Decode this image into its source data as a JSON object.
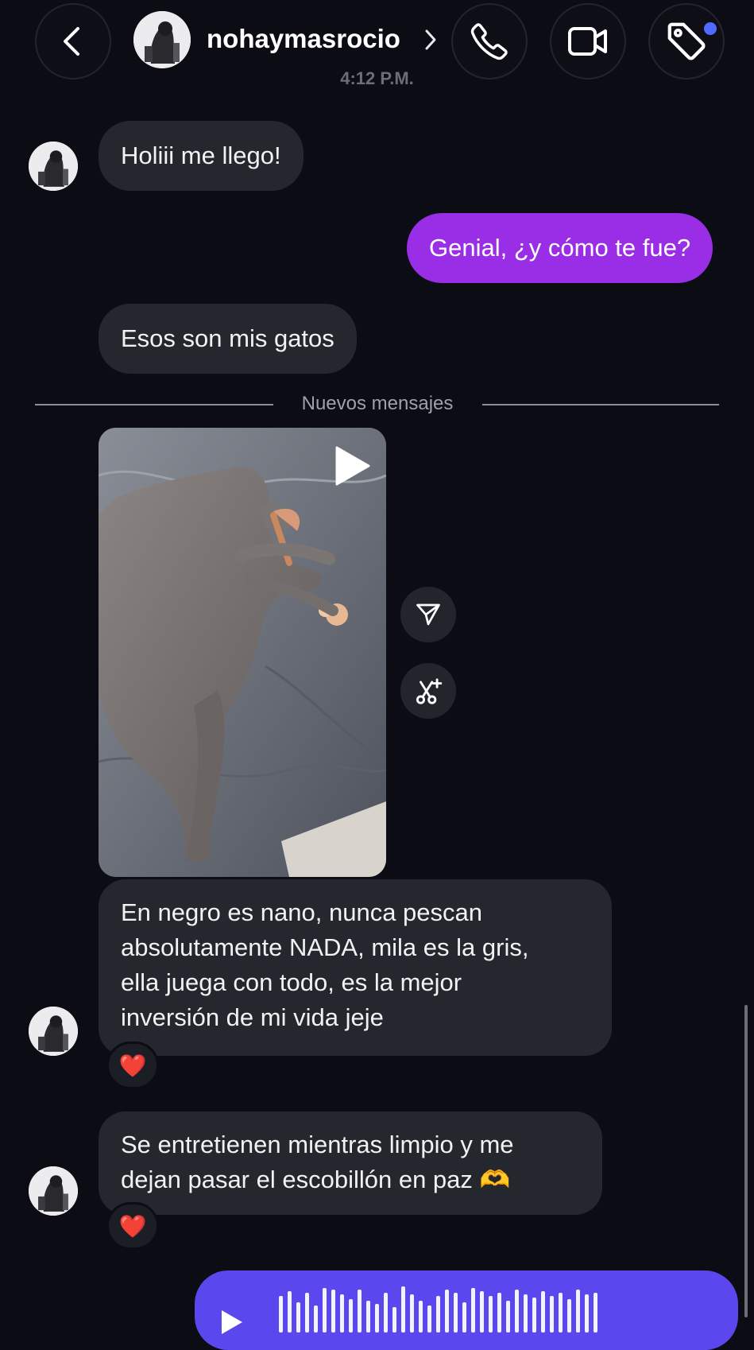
{
  "header": {
    "username": "nohaymasrocio",
    "timestamp": "4:12 P.M.",
    "icons": {
      "back": "chevron-left-icon",
      "profile": "chevron-right-icon",
      "call": "phone-icon",
      "video": "video-camera-icon",
      "tag": "tag-icon"
    }
  },
  "messages": {
    "m1": "Holiii me llego!",
    "m2": "Genial, ¿y cómo te fue?",
    "m3": "Esos son mis gatos",
    "divider": "Nuevos mensajes",
    "m4": [
      "En negro es nano, nunca pescan",
      "absolutamente NADA, mila es la gris,",
      "ella juega con todo, es la mejor",
      "inversión de mi vida jeje"
    ],
    "m5": [
      "Se entretienen mientras limpio y me",
      "dejan pasar el escobillón en paz 🫶"
    ],
    "reaction": "❤️"
  },
  "colors": {
    "background": "#0b0c14",
    "incoming_bubble": "#25272e",
    "outgoing_bubble": "#9a2ee6",
    "voice_bubble": "#5a47ee",
    "notification_dot": "#4f6bff"
  }
}
